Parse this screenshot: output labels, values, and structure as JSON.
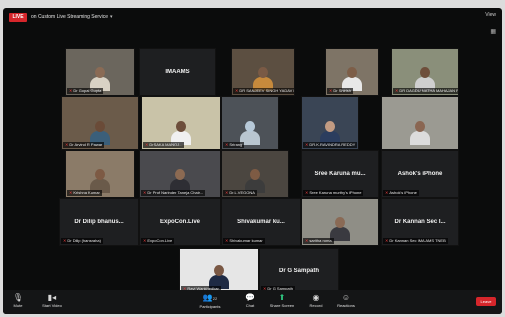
{
  "topbar": {
    "live_badge": "LIVE",
    "stream_label": "on Custom Live Streaming Service",
    "view_label": "View"
  },
  "tiles": [
    {
      "name_tag": "Dr Gopal Gupta",
      "center": "",
      "video": true,
      "skin": "#8a6b55",
      "shirt": "#d9d2c4",
      "bg": "#6b665d"
    },
    {
      "name_tag": "",
      "center": "IMAAMS",
      "video": false
    },
    {
      "name_tag": "DR SANJEEV SINGH YADAV NATI...",
      "center": "",
      "video": true,
      "skin": "#7a5a45",
      "shirt": "#c78a3c",
      "bg": "#5c4f41"
    },
    {
      "name_tag": "Dr Shirish",
      "center": "",
      "video": true,
      "skin": "#7d5e48",
      "shirt": "#e8e8e8",
      "bg": "#7e7466"
    },
    {
      "name_tag": "DR DAGDU NATHA MAHAJAN RAD...",
      "center": "",
      "video": true,
      "skin": "#6e4e3a",
      "shirt": "#cfcfcf",
      "bg": "#8a8f7a"
    },
    {
      "name_tag": "Dr Arvind R Pawar",
      "center": "",
      "video": true,
      "skin": "#6a4b38",
      "shirt": "#3b5f7a",
      "bg": "#6b5b4a"
    },
    {
      "name_tag": "DrSAKA MANOJ...",
      "center": "",
      "video": true,
      "skin": "#6d4e3b",
      "shirt": "#f0f0f0",
      "bg": "#c9c3a8"
    },
    {
      "name_tag": "Srirang",
      "center": "",
      "video": true,
      "skin": "#b7c9d8",
      "shirt": "#b9c6d0",
      "bg": "#4d5258"
    },
    {
      "name_tag": "DR.K.RAVINDRA REDDY",
      "center": "",
      "video": true,
      "skin": "#c29b82",
      "shirt": "#2b3d5e",
      "bg": "#3a4555"
    },
    {
      "name_tag": "",
      "center": "",
      "video": true,
      "skin": "#8a6652",
      "shirt": "#dcdcdc",
      "bg": "#9b9a92"
    },
    {
      "name_tag": "Krishna Kumar",
      "center": "",
      "video": true,
      "skin": "#7d5a44",
      "shirt": "#6a5a4a",
      "bg": "#8b7b68"
    },
    {
      "name_tag": "Dr Prof Narinder Taneja Chair...",
      "center": "",
      "video": true,
      "skin": "#8c6a52",
      "shirt": "#2e2e34",
      "bg": "#4a4a4e"
    },
    {
      "name_tag": "Dr.L.VEGONA",
      "center": "",
      "video": true,
      "skin": "#7e5b44",
      "shirt": "#3c3c3c",
      "bg": "#4b4640"
    },
    {
      "name_tag": "Sree Karuna murthy's iPhone",
      "center": "Sree Karuna mu...",
      "video": false
    },
    {
      "name_tag": "Ashok's iPhone",
      "center": "Ashok's iPhone",
      "video": false
    },
    {
      "name_tag": "Dr Dilip (hansraha)",
      "center": "Dr Dilip bhanus...",
      "video": false
    },
    {
      "name_tag": "ExpoCon.Live",
      "center": "ExpoCon.Live",
      "video": false
    },
    {
      "name_tag": "Shivakumar kumar",
      "center": "Shivakumar ku...",
      "video": false
    },
    {
      "name_tag": "saritha roma",
      "center": "",
      "video": true,
      "skin": "#8a6a55",
      "shirt": "#3a3a40",
      "bg": "#8f8e86"
    },
    {
      "name_tag": "Dr Kannan Sec IMA AMS TNEB",
      "center": "Dr Kannan Sec I...",
      "video": false
    },
    {
      "name_tag": "Ravi Wankhedkar",
      "center": "",
      "video": true,
      "skin": "#7a5844",
      "shirt": "#1e2a44",
      "bg": "#e6e6e6"
    },
    {
      "name_tag": "Dr G Sampath",
      "center": "Dr G Sampath",
      "video": false
    }
  ],
  "toolbar": {
    "mute": "Mute",
    "stop_video": "Start Video",
    "participants": "Participants",
    "participants_count": "22",
    "chat": "Chat",
    "share": "Share Screen",
    "record": "Record",
    "reactions": "Reactions",
    "leave": "Leave"
  }
}
